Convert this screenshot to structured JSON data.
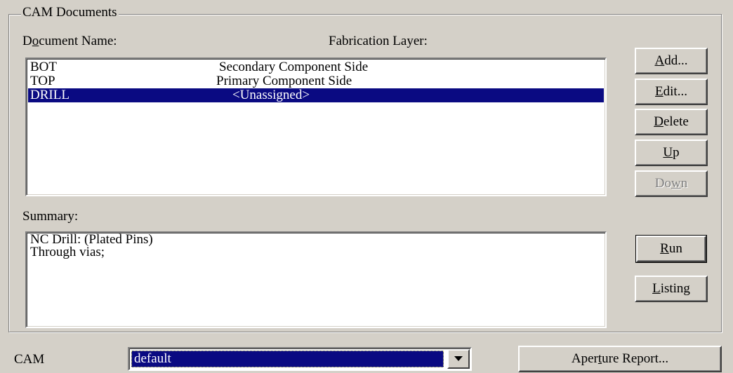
{
  "cam_documents_group": {
    "title": "CAM Documents",
    "document_name_label": "Document Name:",
    "fabrication_layer_label": "Fabrication Layer:",
    "documents": [
      {
        "name": "BOT",
        "layer": "Secondary Component Side",
        "selected": false
      },
      {
        "name": "TOP",
        "layer": "Primary Component Side",
        "selected": false
      },
      {
        "name": "DRILL",
        "layer": "<Unassigned>",
        "selected": true
      }
    ],
    "summary_label": "Summary:",
    "summary_lines": [
      "NC Drill: (Plated Pins)",
      "Through vias;"
    ]
  },
  "buttons": {
    "add": {
      "mnemonic": "A",
      "rest": "dd..."
    },
    "edit": {
      "mnemonic": "E",
      "rest": "dit..."
    },
    "delete": {
      "mnemonic": "D",
      "rest": "elete"
    },
    "up": {
      "mnemonic": "U",
      "rest": "p",
      "pre": ""
    },
    "down": {
      "pre": "Do",
      "mnemonic": "w",
      "rest": "n",
      "disabled": true
    },
    "run": {
      "mnemonic": "R",
      "rest": "un"
    },
    "listing": {
      "mnemonic": "L",
      "rest": "isting"
    },
    "aperture_report": {
      "pre": "Aper",
      "mnemonic": "t",
      "rest": "ure Report..."
    }
  },
  "cam_selector": {
    "label": "CAM",
    "value": "default"
  },
  "colors": {
    "selection": "#0a0a82",
    "face": "#d4d0c8"
  },
  "icons": {
    "dropdown": "chevron-down-icon"
  }
}
